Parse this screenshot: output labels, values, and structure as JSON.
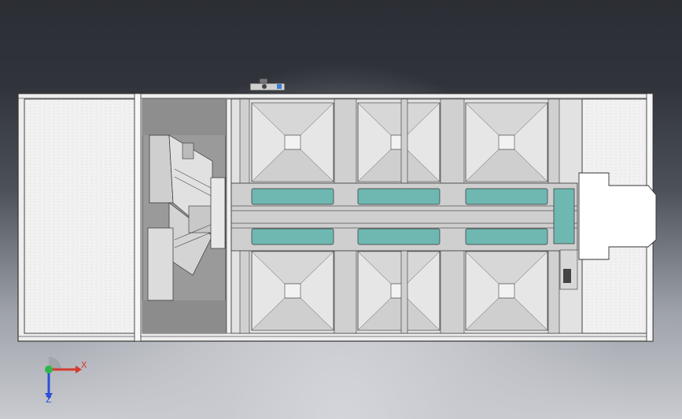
{
  "viewport": {
    "background_top": "#2b2e34",
    "background_bottom": "#c9cbd0"
  },
  "model": {
    "frame_color": "#ffffff",
    "outline_color": "#3a3a3a",
    "panel_color": "#d9d9d9",
    "conveyor_color": "#6fb8b2",
    "hopper_light": "#e4e4e4",
    "hopper_dark": "#b9b9b9",
    "dark_panel": "#9a9a9a"
  },
  "triad": {
    "x_label": "X",
    "z_label": "Z",
    "x_color": "#d63a2f",
    "y_color": "#2fb84a",
    "z_color": "#2a4fd8"
  }
}
